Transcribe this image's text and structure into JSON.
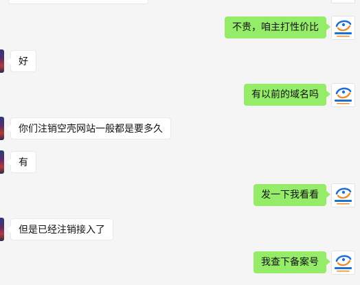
{
  "conversation": {
    "messages": [
      {
        "side": "right",
        "text": "不贵，咱主打性价比"
      },
      {
        "side": "left",
        "text": "好"
      },
      {
        "side": "right",
        "text": "有以前的域名吗"
      },
      {
        "side": "left",
        "text": "你们注销空壳网站一般都是要多久"
      },
      {
        "side": "left",
        "text": "有"
      },
      {
        "side": "right",
        "text": "发一下我看看"
      },
      {
        "side": "left",
        "text": "但是已经注销接入了"
      },
      {
        "side": "right",
        "text": "我查下备案号"
      }
    ]
  },
  "colors": {
    "background": "#f5f5f5",
    "outgoing_bubble": "#95ec69",
    "incoming_bubble": "#ffffff",
    "logo_blue": "#1f6fd1",
    "logo_orange": "#f08a24"
  },
  "icons": {
    "contact_avatar": "partial-photo-avatar",
    "self_avatar": "company-logo-avatar"
  }
}
